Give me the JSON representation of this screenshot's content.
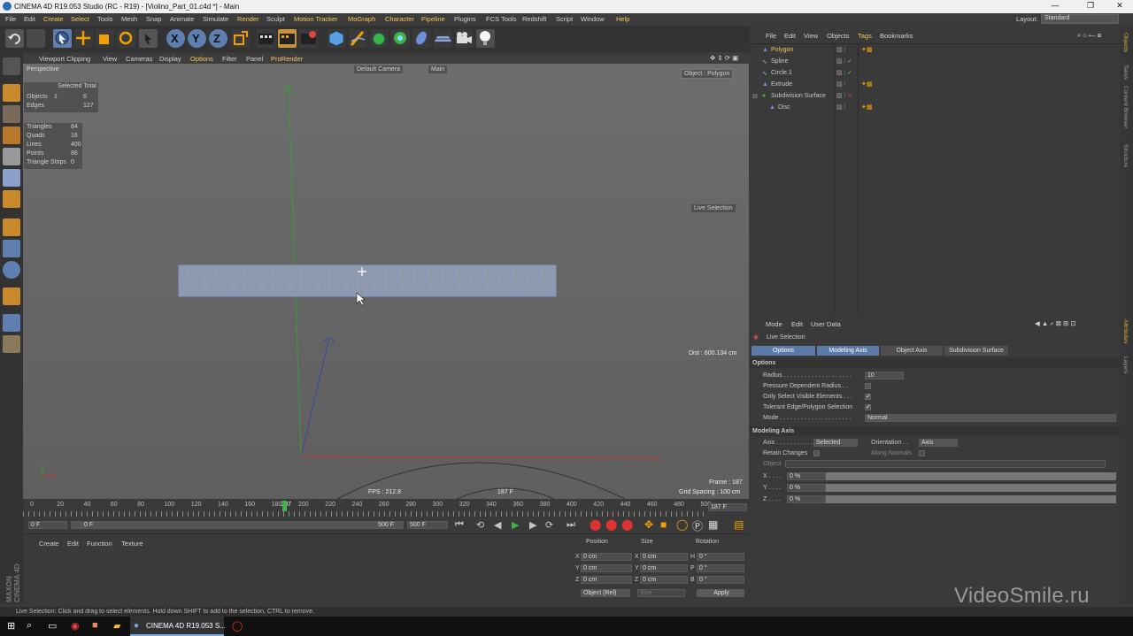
{
  "window": {
    "title": "CINEMA 4D R19.053 Studio (RC - R19) - [Violino_Part_01.c4d *] - Main",
    "min": "—",
    "max": "❐",
    "close": "✕"
  },
  "menu": [
    {
      "label": "File"
    },
    {
      "label": "Edit"
    },
    {
      "label": "Create"
    },
    {
      "label": "Select"
    },
    {
      "label": "Tools"
    },
    {
      "label": "Mesh"
    },
    {
      "label": "Snap"
    },
    {
      "label": "Animate"
    },
    {
      "label": "Simulate"
    },
    {
      "label": "Render"
    },
    {
      "label": "Sculpt"
    },
    {
      "label": "Motion Tracker"
    },
    {
      "label": "MoGraph"
    },
    {
      "label": "Character"
    },
    {
      "label": "Pipeline"
    },
    {
      "label": "Plugins"
    },
    {
      "label": "FCS Tools"
    },
    {
      "label": "Redshift"
    },
    {
      "label": "Script"
    },
    {
      "label": "Window"
    },
    {
      "label": "Help"
    }
  ],
  "layout": {
    "label": "Layout:",
    "value": "Standard"
  },
  "viewport_menu": [
    "Viewport Clipping",
    "View",
    "Cameras",
    "Display",
    "Options",
    "Filter",
    "Panel",
    "ProRender"
  ],
  "viewport": {
    "name": "Perspective",
    "camera": "Default Camera",
    "main": "Main",
    "object_badge": "Object : Polygon",
    "selected_total": {
      "header": "Selected Total",
      "rows": [
        [
          "Objects",
          "1",
          "6"
        ],
        [
          "Edges",
          "",
          "127"
        ]
      ]
    },
    "stats": [
      [
        "Triangles",
        "84"
      ],
      [
        "Quads",
        "16"
      ],
      [
        "Lines",
        "400"
      ],
      [
        "Points",
        "86"
      ],
      [
        "Triangle Strips",
        "0"
      ]
    ],
    "live_selection": "Live Selection",
    "dist": "Dist : 600.134 cm",
    "frame": "Frame : 187",
    "grid": "Grid Spacing : 100 cm",
    "fps": "FPS : 212.8",
    "frame_center": "187 F"
  },
  "timeline": {
    "ticks": [
      "0",
      "20",
      "40",
      "60",
      "80",
      "100",
      "120",
      "140",
      "160",
      "180",
      "187",
      "200",
      "220",
      "240",
      "260",
      "280",
      "300",
      "320",
      "340",
      "360",
      "380",
      "400",
      "420",
      "440",
      "460",
      "480",
      "500"
    ],
    "current": "187",
    "current_field": "187 F"
  },
  "transport": {
    "start": "0 F",
    "range_start": "0 F",
    "range_end": "500 F",
    "end": "500 F"
  },
  "material": {
    "menu": [
      "Create",
      "Edit",
      "Function",
      "Texture"
    ]
  },
  "coordinates": {
    "headers": [
      "Position",
      "Size",
      "Rotation"
    ],
    "rows": [
      [
        "X",
        "0 cm",
        "X",
        "0 cm",
        "H",
        "0 °"
      ],
      [
        "Y",
        "0 cm",
        "Y",
        "0 cm",
        "P",
        "0 °"
      ],
      [
        "Z",
        "0 cm",
        "Z",
        "0 cm",
        "B",
        "0 °"
      ]
    ],
    "mode": "Object (Rel)",
    "size_mode": "Size",
    "apply": "Apply"
  },
  "object_manager": {
    "menu": [
      "File",
      "Edit",
      "View",
      "Objects",
      "Tags",
      "Bookmarks"
    ],
    "objects": [
      {
        "name": "Polygon"
      },
      {
        "name": "Spline"
      },
      {
        "name": "Circle.1"
      },
      {
        "name": "Extrude"
      },
      {
        "name": "Subdivision Surface"
      },
      {
        "name": "Disc"
      }
    ]
  },
  "attributes": {
    "menu": [
      "Mode",
      "Edit",
      "User Data"
    ],
    "tool": "Live Selection",
    "tabs": [
      "Options",
      "Modeling Axis",
      "Object Axis",
      "Subdivision Surface"
    ],
    "options_header": "Options",
    "radius_label": "Radius . . . . . . . . . . . . . . . . . . . .",
    "radius": "10",
    "pressure": "Pressure Dependent Radius . .",
    "visible": "Only Select Visible Elements . . .",
    "tolerant": "Tolerant Edge/Polygon Selection",
    "mode_label": "Mode . . . . . . . . . . . . . . . . . . . . .",
    "mode": "Normal",
    "axis_header": "Modeling Axis",
    "axis_label": "Axis . . . . . . . . . . .",
    "axis": "Selected",
    "orient_label": "Orientation . .",
    "orient": "Axis",
    "retain": "Retain Changes",
    "along": "Along Normals",
    "object": "Object",
    "xyz": [
      [
        "X . . . .",
        "0 %"
      ],
      [
        "Y . . . .",
        "0 %"
      ],
      [
        "Z . . . .",
        "0 %"
      ]
    ]
  },
  "right_strip": [
    "Objects",
    "Takes",
    "Content Browser",
    "Structure"
  ],
  "right_strip2": [
    "Attributes",
    "Layers"
  ],
  "status": "Live Selection: Click and drag to select elements. Hold down SHIFT to add to the selection, CTRL to remove.",
  "taskbar": {
    "app": "CINEMA 4D R19.053 S..."
  },
  "watermark": "VideoSmile.ru",
  "maxon": "MAXON CINEMA 4D"
}
